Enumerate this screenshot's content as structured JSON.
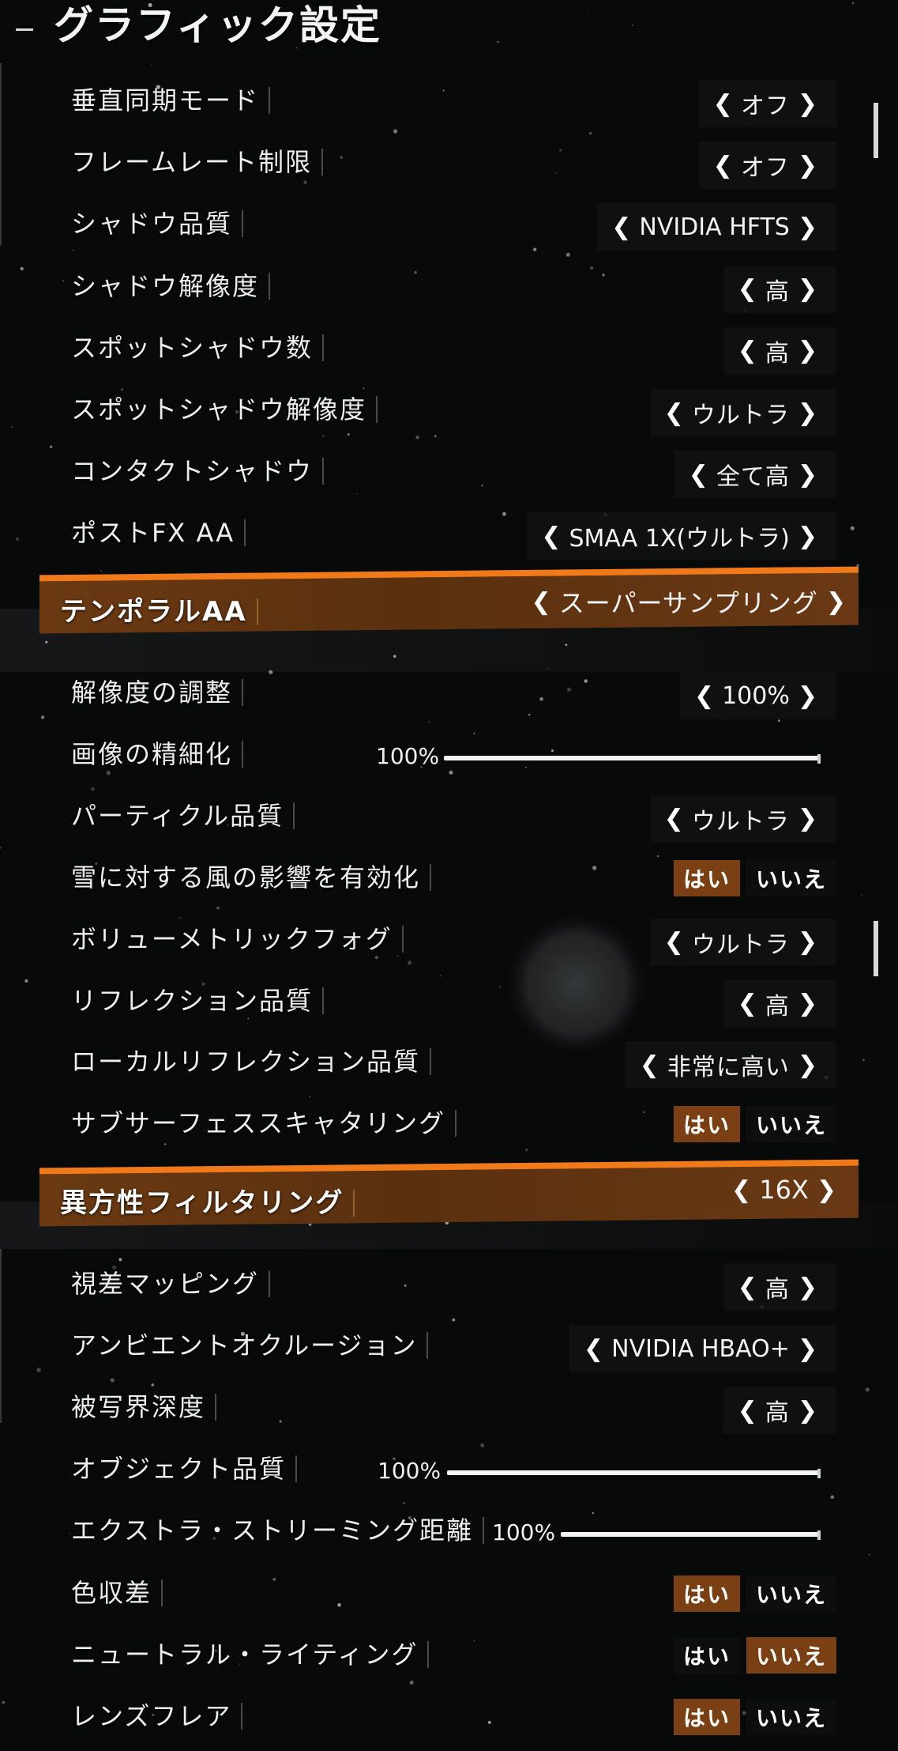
{
  "page_title": "グラフィック設定",
  "rows_top": [
    {
      "label": "垂直同期モード",
      "value": "オフ"
    },
    {
      "label": "フレームレート制限",
      "value": "オフ"
    },
    {
      "label": "シャドウ品質",
      "value": "NVIDIA HFTS"
    },
    {
      "label": "シャドウ解像度",
      "value": "高"
    },
    {
      "label": "スポットシャドウ数",
      "value": "高"
    },
    {
      "label": "スポットシャドウ解像度",
      "value": "ウルトラ"
    },
    {
      "label": "コンタクトシャドウ",
      "value": "全て高"
    },
    {
      "label": "ポストFX AA",
      "value": "SMAA 1X(ウルトラ)"
    }
  ],
  "highlight1": {
    "label": "テンポラルAA",
    "value": "スーパーサンプリング"
  },
  "rows_mid": [
    {
      "label": "解像度の調整",
      "type": "select",
      "value": "100%"
    },
    {
      "label": "画像の精細化",
      "type": "slider",
      "value": "100%"
    },
    {
      "label": "パーティクル品質",
      "type": "select",
      "value": "ウルトラ"
    },
    {
      "label": "雪に対する風の影響を有効化",
      "type": "toggle",
      "yes": "はい",
      "no": "いいえ",
      "selected": "yes"
    },
    {
      "label": "ボリューメトリックフォグ",
      "type": "select",
      "value": "ウルトラ"
    },
    {
      "label": "リフレクション品質",
      "type": "select",
      "value": "高"
    },
    {
      "label": "ローカルリフレクション品質",
      "type": "select",
      "value": "非常に高い"
    },
    {
      "label": "サブサーフェススキャタリング",
      "type": "toggle",
      "yes": "はい",
      "no": "いいえ",
      "selected": "yes"
    }
  ],
  "highlight2": {
    "label": "異方性フィルタリング",
    "value": "16X"
  },
  "rows_bottom": [
    {
      "label": "視差マッピング",
      "type": "select",
      "value": "高"
    },
    {
      "label": "アンビエントオクルージョン",
      "type": "select",
      "value": "NVIDIA HBAO+"
    },
    {
      "label": "被写界深度",
      "type": "select",
      "value": "高"
    },
    {
      "label": "オブジェクト品質",
      "type": "slider",
      "value": "100%"
    },
    {
      "label": "エクストラ・ストリーミング距離",
      "type": "slider",
      "value": "100%"
    },
    {
      "label": "色収差",
      "type": "toggle",
      "yes": "はい",
      "no": "いいえ",
      "selected": "yes"
    },
    {
      "label": "ニュートラル・ライティング",
      "type": "toggle",
      "yes": "はい",
      "no": "いいえ",
      "selected": "no"
    },
    {
      "label": "レンズフレア",
      "type": "toggle",
      "yes": "はい",
      "no": "いいえ",
      "selected": "yes"
    }
  ],
  "icons": {
    "left_arrow": "chevron-left-icon",
    "right_arrow": "chevron-right-icon"
  },
  "colors": {
    "accent": "#f07a1a",
    "highlight_bg": "#6b3a12",
    "selected_toggle": "#7a3f12",
    "background": "#080909"
  }
}
